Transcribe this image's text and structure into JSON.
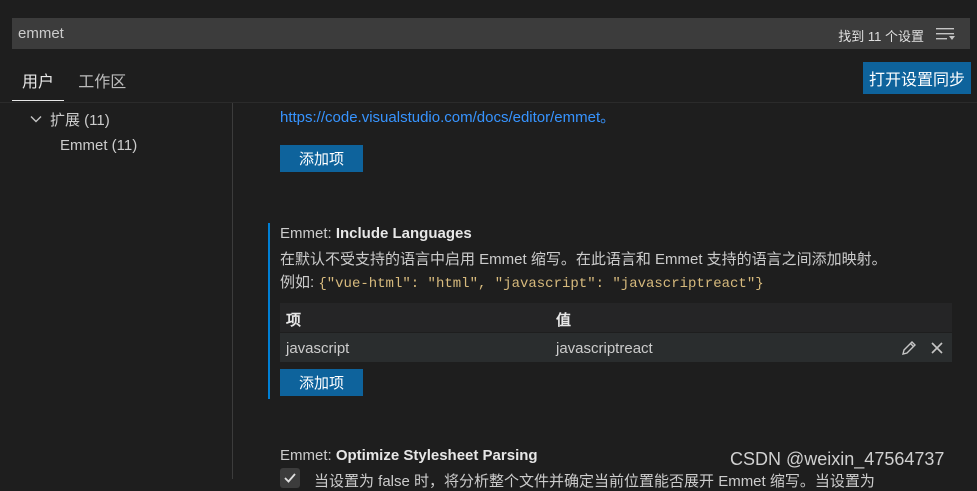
{
  "search": {
    "value": "emmet",
    "result_count": "找到 11 个设置"
  },
  "tabs": [
    {
      "label": "用户"
    },
    {
      "label": "工作区"
    }
  ],
  "sync_button": "打开设置同步",
  "toc": {
    "extensions": "扩展 (11)",
    "emmet": "Emmet (11)"
  },
  "prev_setting": {
    "link": "https://code.visualstudio.com/docs/editor/emmet。",
    "add_button": "添加项"
  },
  "include_languages": {
    "category": "Emmet: ",
    "name": "Include Languages",
    "description": "在默认不受支持的语言中启用 Emmet 缩写。在此语言和 Emmet 支持的语言之间添加映射。",
    "example_prefix": "例如: ",
    "example_code": "{\"vue-html\": \"html\", \"javascript\": \"javascriptreact\"}",
    "table": {
      "headers": [
        "项",
        "值"
      ],
      "rows": [
        {
          "key": "javascript",
          "value": "javascriptreact"
        }
      ]
    },
    "add_button": "添加项"
  },
  "optimize_stylesheet": {
    "category": "Emmet: ",
    "name": "Optimize Stylesheet Parsing",
    "description_partial": "当设置为 false 时，将分析整个文件并确定当前位置能否展开 Emmet 缩写。当设置为"
  },
  "watermark": "CSDN @weixin_47564737",
  "colors": {
    "accent": "#0e639c",
    "link": "#3794ff",
    "focus": "#007fd4",
    "code": "#d7ba7d"
  }
}
